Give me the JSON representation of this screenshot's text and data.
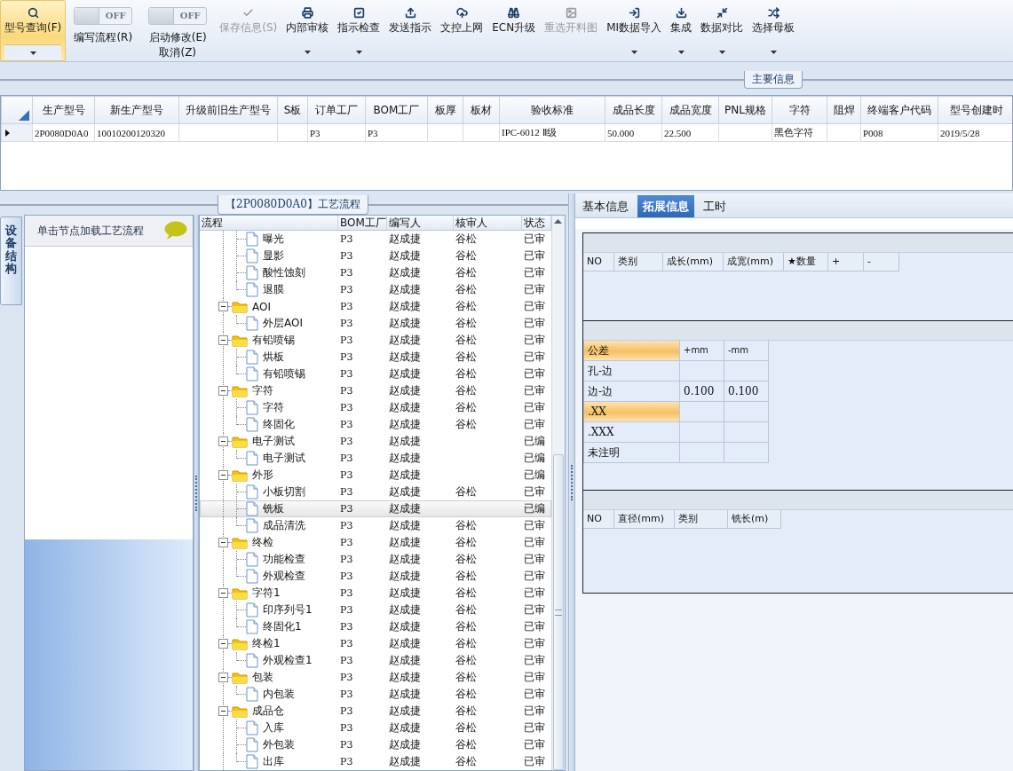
{
  "toolbar": [
    {
      "kind": "button",
      "label": "型号查询(F)",
      "selected": true,
      "disabled": false,
      "dropdown": true
    },
    {
      "kind": "toggle",
      "switch_text": "OFF",
      "on": false,
      "labels": [
        "编写流程(R)"
      ]
    },
    {
      "kind": "toggle",
      "switch_text": "OFF",
      "on": false,
      "labels": [
        "启动修改(E)",
        "取消(Z)"
      ]
    },
    {
      "kind": "button",
      "label": "保存信息(S)",
      "selected": false,
      "disabled": true,
      "dropdown": false
    },
    {
      "kind": "button",
      "label": "内部审核",
      "selected": false,
      "disabled": false,
      "dropdown": true
    },
    {
      "kind": "button",
      "label": "指示检查",
      "selected": false,
      "disabled": false,
      "dropdown": true
    },
    {
      "kind": "button",
      "label": "发送指示",
      "selected": false,
      "disabled": false,
      "dropdown": false
    },
    {
      "kind": "button",
      "label": "文控上网",
      "selected": false,
      "disabled": false,
      "dropdown": false
    },
    {
      "kind": "button",
      "label": "ECN升级",
      "selected": false,
      "disabled": false,
      "dropdown": false
    },
    {
      "kind": "button",
      "label": "重选开料图",
      "selected": false,
      "disabled": true,
      "dropdown": false
    },
    {
      "kind": "button",
      "label": "MI数据导入",
      "selected": false,
      "disabled": false,
      "dropdown": true
    },
    {
      "kind": "button",
      "label": "集成",
      "selected": false,
      "disabled": false,
      "dropdown": true
    },
    {
      "kind": "button",
      "label": "数据对比",
      "selected": false,
      "disabled": false,
      "dropdown": true
    },
    {
      "kind": "button",
      "label": "选择母板",
      "selected": false,
      "disabled": false,
      "dropdown": true
    }
  ],
  "main_info": {
    "title": "主要信息",
    "columns": [
      "生产型号",
      "新生产型号",
      "升级前旧生产型号",
      "S板",
      "订单工厂",
      "BOM工厂",
      "板厚",
      "板材",
      "验收标准",
      "成品长度",
      "成品宽度",
      "PNL规格",
      "字符",
      "阻焊",
      "终端客户代码",
      "型号创建时"
    ],
    "rows": [
      {
        "current": true,
        "cells": [
          "2P0080D0A0",
          "10010200120320",
          null,
          null,
          "P3",
          "P3",
          null,
          null,
          "IPC-6012 Ⅱ级",
          "50.000",
          "22.500",
          null,
          "黑色字符",
          null,
          "P008",
          "2019/5/28"
        ]
      }
    ]
  },
  "process": {
    "title": "【2P0080D0A0】工艺流程",
    "side_tab": "设备结构",
    "hint": "单击节点加载工艺流程",
    "columns": [
      "流程",
      "BOM工厂",
      "编写人",
      "核审人",
      "状态"
    ],
    "tree": [
      {
        "children": [
          {
            "name": "曝光",
            "factory": "P3",
            "writer": "赵成捷",
            "reviewer": "谷松",
            "status": "已审",
            "selected": false
          },
          {
            "name": "显影",
            "factory": "P3",
            "writer": "赵成捷",
            "reviewer": "谷松",
            "status": "已审",
            "selected": false
          },
          {
            "name": "酸性蚀刻",
            "factory": "P3",
            "writer": "赵成捷",
            "reviewer": "谷松",
            "status": "已审",
            "selected": false
          },
          {
            "name": "退膜",
            "factory": "P3",
            "writer": "赵成捷",
            "reviewer": "谷松",
            "status": "已审",
            "selected": false
          }
        ]
      },
      {
        "name": "AOI",
        "factory": "P3",
        "writer": "赵成捷",
        "reviewer": "谷松",
        "status": "已审",
        "expanded": true,
        "children": [
          {
            "name": "外层AOI",
            "factory": "P3",
            "writer": "赵成捷",
            "reviewer": "谷松",
            "status": "已审",
            "selected": false
          }
        ]
      },
      {
        "name": "有铅喷锡",
        "factory": "P3",
        "writer": "赵成捷",
        "reviewer": "谷松",
        "status": "已审",
        "expanded": true,
        "children": [
          {
            "name": "烘板",
            "factory": "P3",
            "writer": "赵成捷",
            "reviewer": "谷松",
            "status": "已审",
            "selected": false
          },
          {
            "name": "有铅喷锡",
            "factory": "P3",
            "writer": "赵成捷",
            "reviewer": "谷松",
            "status": "已审",
            "selected": false
          }
        ]
      },
      {
        "name": "字符",
        "factory": "P3",
        "writer": "赵成捷",
        "reviewer": "谷松",
        "status": "已审",
        "expanded": true,
        "children": [
          {
            "name": "字符",
            "factory": "P3",
            "writer": "赵成捷",
            "reviewer": "谷松",
            "status": "已审",
            "selected": false
          },
          {
            "name": "终固化",
            "factory": "P3",
            "writer": "赵成捷",
            "reviewer": "谷松",
            "status": "已审",
            "selected": false
          }
        ]
      },
      {
        "name": "电子测试",
        "factory": "P3",
        "writer": "赵成捷",
        "status": "已编",
        "expanded": true,
        "children": [
          {
            "name": "电子测试",
            "factory": "P3",
            "writer": "赵成捷",
            "status": "已编",
            "selected": false
          }
        ]
      },
      {
        "name": "外形",
        "factory": "P3",
        "writer": "赵成捷",
        "status": "已编",
        "expanded": true,
        "children": [
          {
            "name": "小板切割",
            "factory": "P3",
            "writer": "赵成捷",
            "reviewer": "谷松",
            "status": "已审",
            "selected": false
          },
          {
            "name": "铣板",
            "factory": "P3",
            "writer": "赵成捷",
            "status": "已编",
            "selected": true
          },
          {
            "name": "成品清洗",
            "factory": "P3",
            "writer": "赵成捷",
            "reviewer": "谷松",
            "status": "已审",
            "selected": false
          }
        ]
      },
      {
        "name": "终检",
        "factory": "P3",
        "writer": "赵成捷",
        "reviewer": "谷松",
        "status": "已审",
        "expanded": true,
        "children": [
          {
            "name": "功能检查",
            "factory": "P3",
            "writer": "赵成捷",
            "reviewer": "谷松",
            "status": "已审",
            "selected": false
          },
          {
            "name": "外观检查",
            "factory": "P3",
            "writer": "赵成捷",
            "reviewer": "谷松",
            "status": "已审",
            "selected": false
          }
        ]
      },
      {
        "name": "字符1",
        "factory": "P3",
        "writer": "赵成捷",
        "reviewer": "谷松",
        "status": "已审",
        "expanded": true,
        "children": [
          {
            "name": "印序列号1",
            "factory": "P3",
            "writer": "赵成捷",
            "reviewer": "谷松",
            "status": "已审",
            "selected": false
          },
          {
            "name": "终固化1",
            "factory": "P3",
            "writer": "赵成捷",
            "reviewer": "谷松",
            "status": "已审",
            "selected": false
          }
        ]
      },
      {
        "name": "终检1",
        "factory": "P3",
        "writer": "赵成捷",
        "reviewer": "谷松",
        "status": "已审",
        "expanded": true,
        "children": [
          {
            "name": "外观检查1",
            "factory": "P3",
            "writer": "赵成捷",
            "reviewer": "谷松",
            "status": "已审",
            "selected": false
          }
        ]
      },
      {
        "name": "包装",
        "factory": "P3",
        "writer": "赵成捷",
        "reviewer": "谷松",
        "status": "已审",
        "expanded": true,
        "children": [
          {
            "name": "内包装",
            "factory": "P3",
            "writer": "赵成捷",
            "reviewer": "谷松",
            "status": "已审",
            "selected": false
          }
        ]
      },
      {
        "name": "成品仓",
        "factory": "P3",
        "writer": "赵成捷",
        "reviewer": "谷松",
        "status": "已审",
        "expanded": true,
        "children": [
          {
            "name": "入库",
            "factory": "P3",
            "writer": "赵成捷",
            "reviewer": "谷松",
            "status": "已审",
            "selected": false
          },
          {
            "name": "外包装",
            "factory": "P3",
            "writer": "赵成捷",
            "reviewer": "谷松",
            "status": "已审",
            "selected": false
          },
          {
            "name": "出库",
            "factory": "P3",
            "writer": "赵成捷",
            "reviewer": "谷松",
            "status": "已审",
            "selected": false
          }
        ]
      }
    ]
  },
  "details": {
    "tabs": [
      {
        "label": "基本信息",
        "selected": false
      },
      {
        "label": "拓展信息",
        "selected": true
      },
      {
        "label": "工时",
        "selected": false
      }
    ],
    "size_table": {
      "columns": [
        "NO",
        "类别",
        "成长(mm)",
        "成宽(mm)",
        "★数量",
        "+",
        "-"
      ]
    },
    "tolerance": {
      "columns": [
        "公差",
        "+mm",
        "-mm"
      ],
      "rows": [
        {
          "label": "孔-边",
          "selected": false
        },
        {
          "label": "边-边",
          "plus": "0.100",
          "minus": "0.100",
          "selected": false
        },
        {
          "label": ".XX",
          "selected": true
        },
        {
          "label": ".XXX",
          "selected": false
        },
        {
          "label": "未注明",
          "selected": false
        }
      ]
    },
    "drill_table": {
      "columns": [
        "NO",
        "直径(mm)",
        "类别",
        "铣长(m)"
      ]
    }
  }
}
